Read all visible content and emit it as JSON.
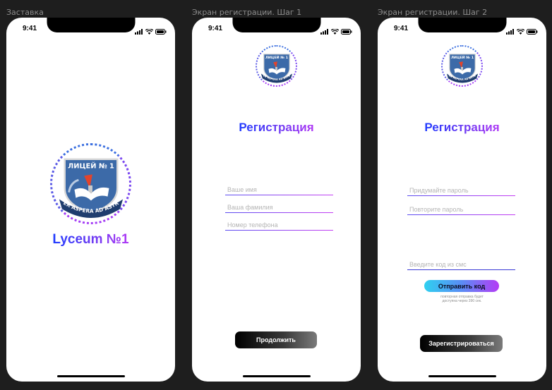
{
  "screens": [
    {
      "label": "Заставка",
      "time": "9:41",
      "title": "Lyceum №1"
    },
    {
      "label": "Экран регистрации. Шаг 1",
      "time": "9:41",
      "title": "Регистрация",
      "fields": [
        {
          "placeholder": "Ваше имя"
        },
        {
          "placeholder": "Ваша фамилия"
        },
        {
          "placeholder": "Номер телефона"
        }
      ],
      "button": "Продолжить"
    },
    {
      "label": "Экран регистрации. Шаг 2",
      "time": "9:41",
      "title": "Регистрация",
      "fields": [
        {
          "placeholder": "Придумайте пароль"
        },
        {
          "placeholder": "Повторите пароль"
        },
        {
          "placeholder": "Введите код из смс"
        }
      ],
      "send_code": "Отправить код",
      "resend_line1": "повторная отправка будет",
      "resend_line2": "доступна через 390 сек.",
      "button": "Зарегистрироваться"
    }
  ],
  "emblem": {
    "top_text": "ЛИЦЕЙ № 1",
    "bottom_text": "PER ASPERA AD ASTRA",
    "colors": {
      "shield": "#3c6aa8",
      "ribbon": "#1f3d6e",
      "torch": "#e2442c"
    }
  },
  "colors": {
    "gradient_start": "#1f3cff",
    "gradient_end": "#b03af5",
    "accent_cyan": "#2fd0f0"
  }
}
